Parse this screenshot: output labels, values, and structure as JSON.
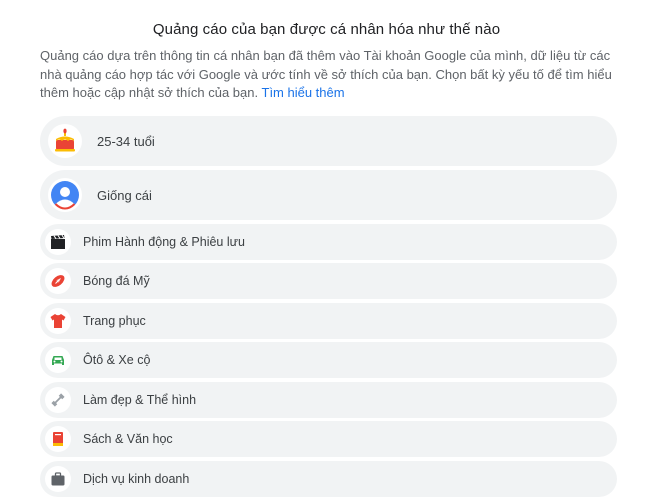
{
  "header": {
    "title": "Quảng cáo của bạn được cá nhân hóa như thế nào",
    "description": "Quảng cáo dựa trên thông tin cá nhân bạn đã thêm vào Tài khoản Google của mình, dữ liệu từ các nhà quảng cáo hợp tác với Google và ước tính về sở thích của bạn. Chọn bất kỳ yếu tố để tìm hiểu thêm hoặc cập nhật sở thích của bạn.",
    "learn_more": "Tìm hiểu thêm"
  },
  "factors": [
    {
      "label": "25-34 tuổi",
      "icon": "birthday-cake-icon"
    },
    {
      "label": "Giống cái",
      "icon": "person-avatar-icon"
    }
  ],
  "interests": [
    {
      "label": "Phim Hành động & Phiêu lưu",
      "icon": "clapperboard-icon"
    },
    {
      "label": "Bóng đá Mỹ",
      "icon": "football-icon"
    },
    {
      "label": "Trang phục",
      "icon": "shirt-icon"
    },
    {
      "label": "Ôtô & Xe cộ",
      "icon": "car-icon"
    },
    {
      "label": "Làm đẹp & Thể hình",
      "icon": "dumbbell-icon"
    },
    {
      "label": "Sách & Văn học",
      "icon": "book-icon"
    },
    {
      "label": "Dịch vụ kinh doanh",
      "icon": "briefcase-icon"
    }
  ],
  "colors": {
    "link": "#1a73e8",
    "row_bg": "#f1f3f4",
    "text": "#3c4043"
  }
}
